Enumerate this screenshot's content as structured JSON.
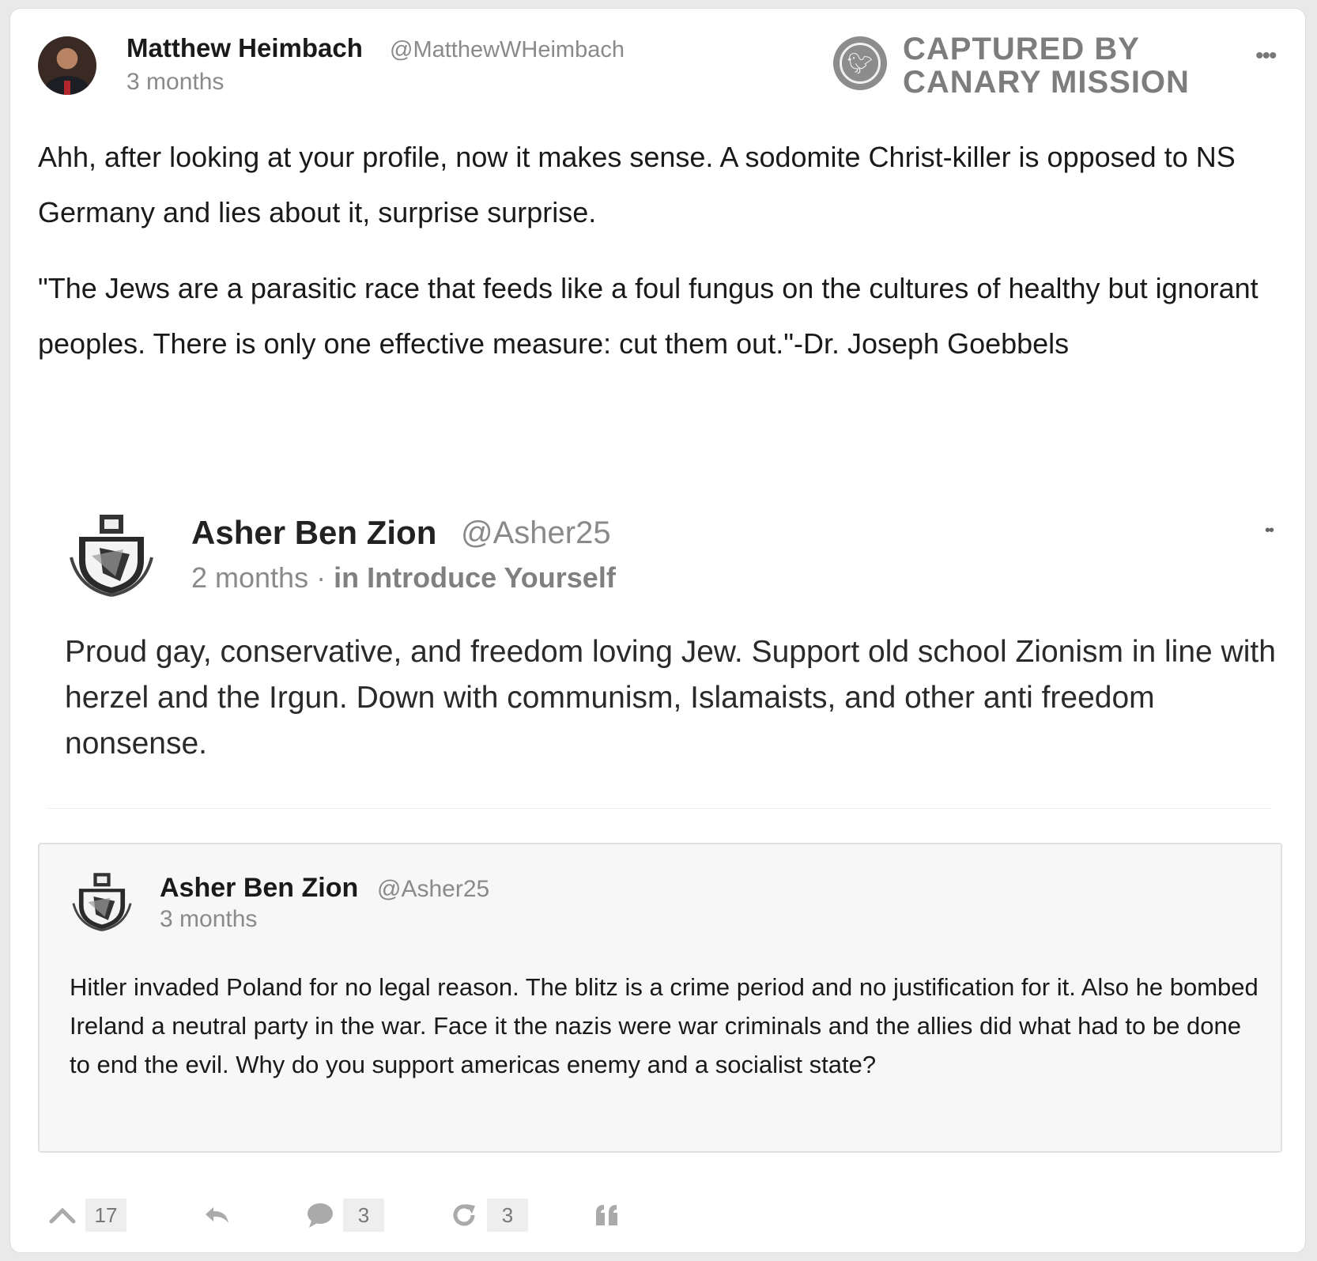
{
  "post": {
    "author_name": "Matthew Heimbach",
    "author_handle": "@MatthewWHeimbach",
    "time": "3 months",
    "paragraphs": [
      "Ahh, after looking at your profile, now it makes sense. A sodomite Christ-killer is opposed to NS Germany and lies about it, surprise surprise.",
      "\"The Jews are a parasitic race that feeds like a foul fungus on the cultures of healthy but ignorant peoples. There is only one effective measure: cut them out.\"-Dr. Joseph Goebbels"
    ]
  },
  "watermark": {
    "line1": "CAPTURED BY",
    "line2": "CANARY MISSION"
  },
  "embedded_screenshot": {
    "author_name": "Asher Ben Zion",
    "author_handle": "@Asher25",
    "time": "2 months",
    "separator": "·",
    "category": "in Introduce Yourself",
    "text": "Proud gay, conservative, and freedom loving Jew. Support old school Zionism in line with herzel and the Irgun. Down with communism, Islamaists, and other anti freedom nonsense."
  },
  "quoted_post": {
    "author_name": "Asher Ben Zion",
    "author_handle": "@Asher25",
    "time": "3 months",
    "text": "Hitler invaded Poland for no legal reason. The blitz is a crime period and no justification for it. Also he bombed Ireland a neutral party in the war. Face it the nazis were war criminals and the allies did what had to be done to end the evil. Why do you support americas enemy and a socialist state?"
  },
  "actions": {
    "upvote_count": "17",
    "comment_count": "3",
    "repost_count": "3",
    "icons": [
      "upvote-icon",
      "reply-icon",
      "comment-icon",
      "repost-icon",
      "quote-icon"
    ]
  },
  "colors": {
    "text": "#1a1a1a",
    "muted": "#8a8a8a",
    "watermark": "#7d7d7d",
    "quote_bg": "#f7f7f7"
  }
}
